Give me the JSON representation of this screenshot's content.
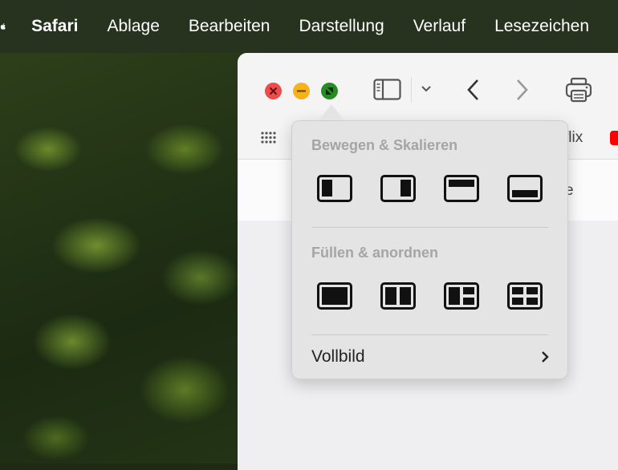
{
  "menubar": {
    "app": "Safari",
    "items": [
      "Ablage",
      "Bearbeiten",
      "Darstellung",
      "Verlauf",
      "Lesezeichen"
    ]
  },
  "toolbar": {
    "bookmark_partial": "flix",
    "content_partial": "e"
  },
  "popover": {
    "section1": "Bewegen & Skalieren",
    "section2": "Füllen & anordnen",
    "fullscreen": "Vollbild",
    "move_layouts": [
      "left-half",
      "right-half",
      "top-half",
      "bottom-half"
    ],
    "fill_layouts": [
      "fill",
      "split-halves",
      "quarters-left-large",
      "quarters"
    ]
  },
  "colors": {
    "close": "#ee4b4b",
    "minimize": "#f5b21a",
    "maximize": "#268b22"
  }
}
